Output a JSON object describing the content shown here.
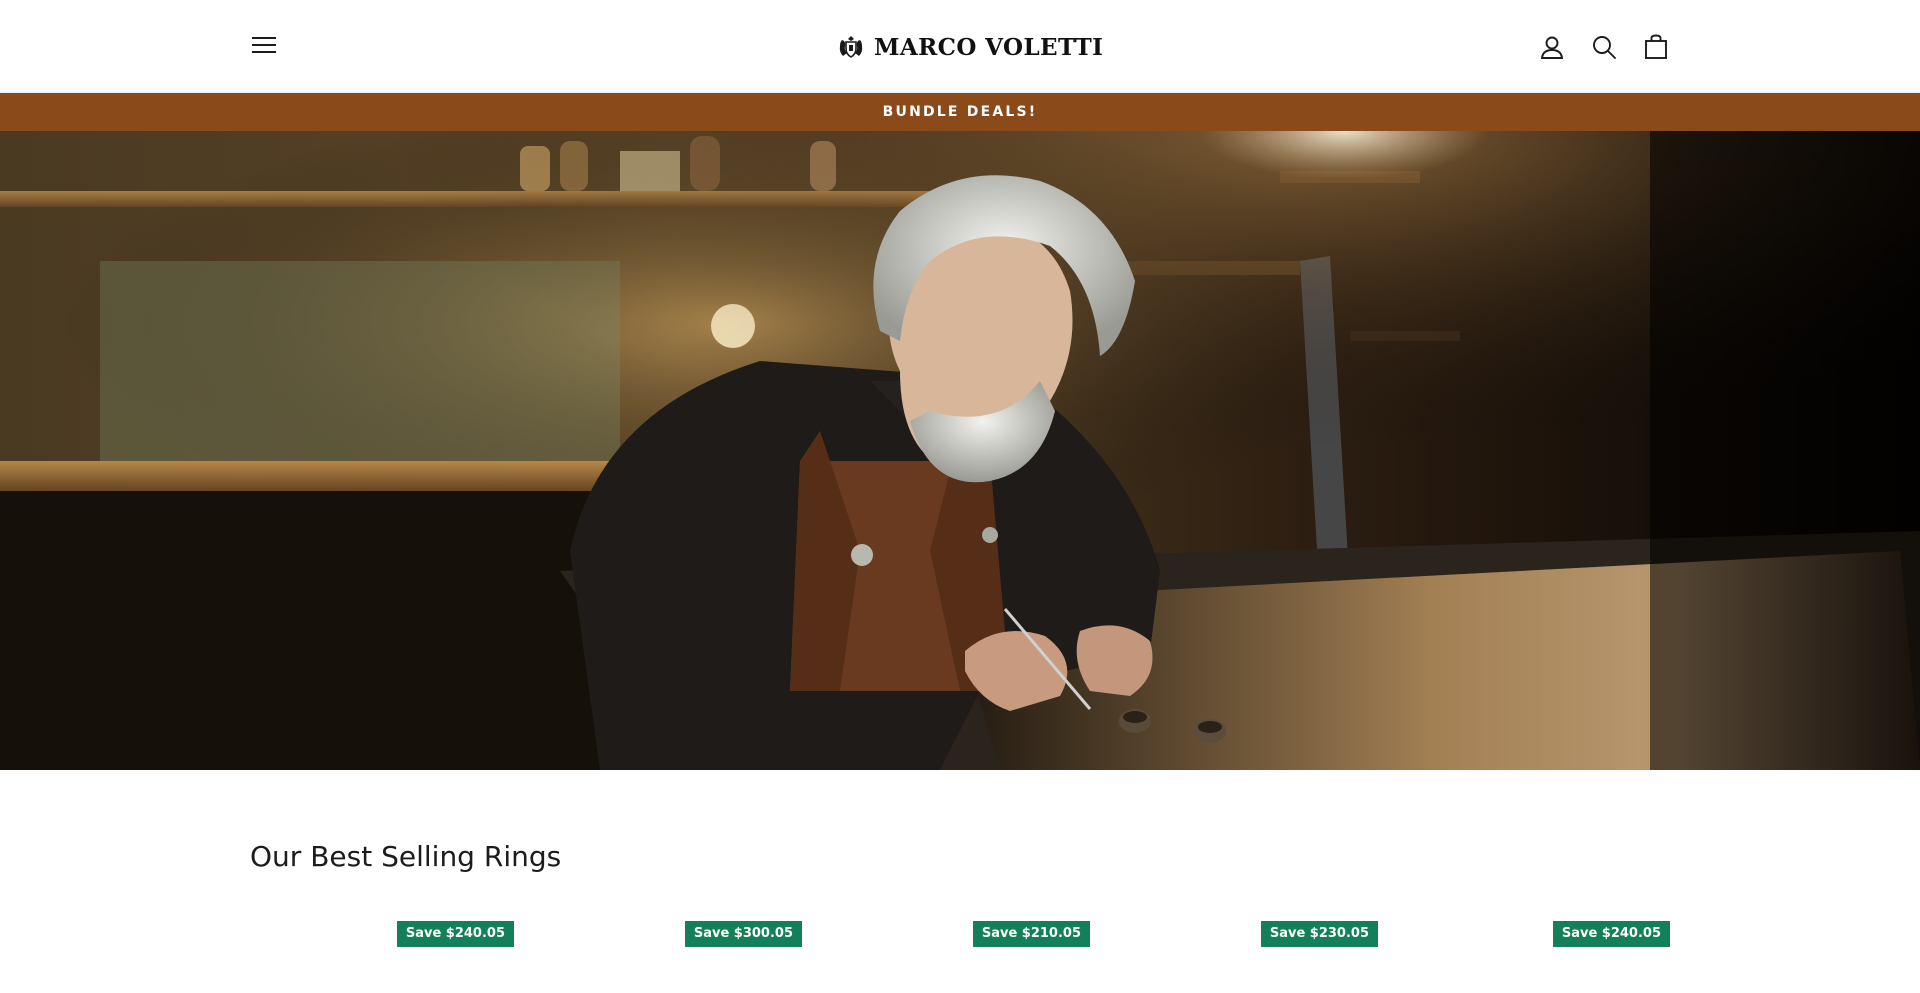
{
  "header": {
    "brand": "MARCO VOLETTI",
    "icons": {
      "menu": "menu-icon",
      "account": "user-icon",
      "search": "search-icon",
      "cart": "shopping-bag-icon"
    }
  },
  "announcement": {
    "text": "BUNDLE DEALS!"
  },
  "hero": {
    "image": "artisan-jeweler-engraving-ring-in-workshop"
  },
  "best_sellers": {
    "title": "Our Best Selling Rings",
    "products": [
      {
        "badge": "Save $240.05"
      },
      {
        "badge": "Save $300.05"
      },
      {
        "badge": "Save $210.05"
      },
      {
        "badge": "Save $230.05"
      },
      {
        "badge": "Save $240.05"
      }
    ]
  },
  "colors": {
    "announcement_bg": "#8b4a1a",
    "badge_bg": "#13805a",
    "text": "#1c1c1c",
    "background": "#ffffff"
  }
}
